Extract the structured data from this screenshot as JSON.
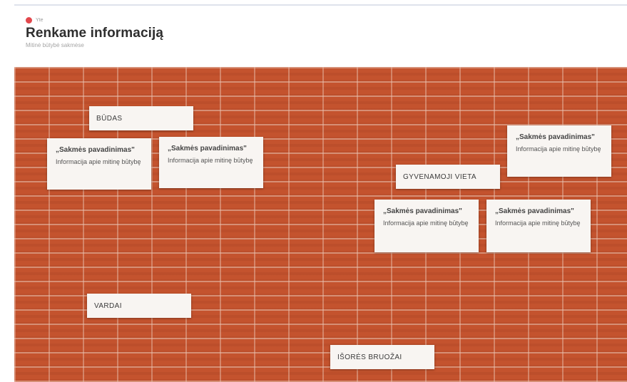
{
  "header": {
    "author": "Yte",
    "title": "Renkame informaciją",
    "subtitle": "Mitinė būtybė sakmėse"
  },
  "colors": {
    "brick": "#c4532e",
    "card": "#f8f5f2",
    "avatar": "#e2474c"
  },
  "sections": {
    "budas": "BŪDAS",
    "gyvenamoji_vieta": "GYVENAMOJI VIETA",
    "vardai": "VARDAI",
    "isores_bruozai": "IŠORĖS BRUOŽAI"
  },
  "notes": [
    {
      "title": "„Sakmės pavadinimas\"",
      "text": "Informacija apie mitinę būtybę"
    },
    {
      "title": "„Sakmės pavadinimas\"",
      "text": "Informacija apie mitinę būtybę"
    },
    {
      "title": "„Sakmės pavadinimas\"",
      "text": "Informacija apie mitinę būtybę"
    },
    {
      "title": "„Sakmės pavadinimas\"",
      "text": "Informacija apie mitinę būtybę"
    },
    {
      "title": "„Sakmės pavadinimas\"",
      "text": "Informacija apie mitinę būtybę"
    }
  ]
}
